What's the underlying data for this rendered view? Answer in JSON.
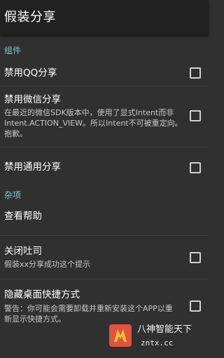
{
  "appbar": {
    "title": "假装分享"
  },
  "sections": {
    "components": {
      "label": "组件"
    },
    "misc": {
      "label": "杂项"
    }
  },
  "prefs": {
    "disable_qq": {
      "title": "禁用QQ分享",
      "checked": false
    },
    "disable_wechat": {
      "title": "禁用微信分享",
      "summary": "在最近的微信SDK版本中，使用了显式Intent而非Intent.ACTION_VIEW。所以Intent不可被重定向。抱歉。",
      "checked": false
    },
    "disable_generic": {
      "title": "禁用通用分享",
      "checked": false
    },
    "help": {
      "title": "查看帮助"
    },
    "close_toast": {
      "title": "关闭吐司",
      "summary": "假装xx分享成功这个提示",
      "checked": false
    },
    "hide_shortcut": {
      "title": "隐藏桌面快捷方式",
      "summary": "警告：你可能会需要卸载并重新安装这个APP以重新显示快捷方式。",
      "checked": false
    }
  },
  "watermark": {
    "line1": "八神智能天下",
    "line2": "zntx.cc"
  },
  "colors": {
    "accent": "#80cbc4",
    "appbar": "#212121",
    "background": "#303030"
  }
}
